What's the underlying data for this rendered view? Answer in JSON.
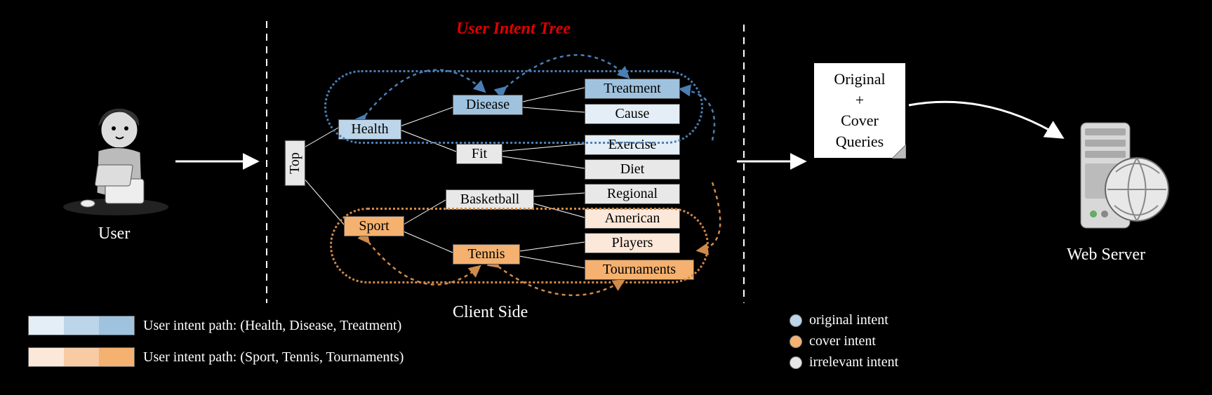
{
  "labels": {
    "user": "User",
    "client_side": "Client Side",
    "tree_title": "User Intent Tree",
    "server": "Web Server",
    "note_line1": "Original",
    "note_plus": "+",
    "note_line2": "Cover",
    "note_line3": "Queries",
    "top": "Top"
  },
  "tree": {
    "level1": {
      "health": "Health",
      "sport": "Sport"
    },
    "level2": {
      "disease": "Disease",
      "fit": "Fit",
      "basketball": "Basketball",
      "tennis": "Tennis"
    },
    "level3": {
      "treatment": "Treatment",
      "cause": "Cause",
      "exercise": "Exercise",
      "diet": "Diet",
      "regional": "Regional",
      "american": "American",
      "players": "Players",
      "tournaments": "Tournaments"
    }
  },
  "legend_left": {
    "row1": "User intent path: (Health, Disease, Treatment)",
    "row2": "User intent path: (Sport, Tennis, Tournaments)"
  },
  "legend_right": {
    "original": "original intent",
    "cover": "cover intent",
    "irrelevant": "irrelevant intent"
  }
}
